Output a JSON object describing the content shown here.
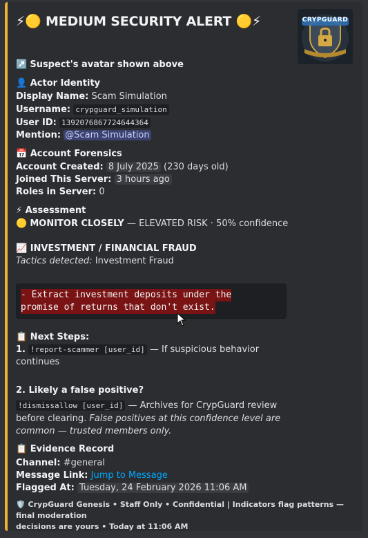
{
  "alert": {
    "title_prefix": "⚡🟡",
    "title": "MEDIUM SECURITY ALERT",
    "title_suffix": "🟡⚡",
    "accent_color": "#f0b232"
  },
  "thumbnail": {
    "alt": "CrypGuard logo",
    "brand_text": "CRYPGUARD",
    "icon": "shield-lock-icon"
  },
  "avatar_note": {
    "emoji": "↗️",
    "text": "Suspect's avatar shown above"
  },
  "actor": {
    "emoji": "👤",
    "header": "Actor Identity",
    "display_name_label": "Display Name:",
    "display_name": "Scam Simulation",
    "username_label": "Username:",
    "username": "crypguard_simulation",
    "user_id_label": "User ID:",
    "user_id": "1392076867724644364",
    "mention_label": "Mention:",
    "mention": "@Scam Simulation"
  },
  "forensics": {
    "emoji": "📅",
    "header": "Account Forensics",
    "created_label": "Account Created:",
    "created": "8 July 2025",
    "created_age": "(230 days old)",
    "joined_label": "Joined This Server:",
    "joined": "3 hours ago",
    "roles_label": "Roles in Server:",
    "roles": "0"
  },
  "assessment": {
    "emoji": "⚡",
    "header": "Assessment",
    "level_emoji": "🟡",
    "level": "MONITOR CLOSELY",
    "detail": "— ELEVATED RISK · 50% confidence"
  },
  "fraud": {
    "emoji": "📈",
    "header": "INVESTMENT / FINANCIAL FRAUD",
    "tactics_label": "Tactics detected:",
    "tactics": "Investment Fraud",
    "code_line_1": "- Extract investment deposits under the",
    "code_line_2": "promise of returns that don't exist."
  },
  "next_steps": {
    "emoji": "📋",
    "header": "Next Steps:",
    "step1_num": "1.",
    "step1_cmd": "!report-scammer [user_id]",
    "step1_text": "— If suspicious behavior",
    "step1_text2": "continues",
    "step2_header": "2. Likely a false positive?",
    "step2_cmd": "!dismissallow [user_id]",
    "step2_text": "— Archives for CrypGuard review",
    "step2_text2": "before clearing.",
    "step2_italic": "False positives at this confidence level are",
    "step2_italic2": "common — trusted members only."
  },
  "evidence": {
    "emoji": "📋",
    "header": "Evidence Record",
    "channel_label": "Channel:",
    "channel": "#general",
    "link_label": "Message Link:",
    "link_text": "Jump to Message",
    "flagged_label": "Flagged At:",
    "flagged": "Tuesday, 24 February 2026 11:06 AM"
  },
  "footer": {
    "icon": "🛡️",
    "line1": "CrypGuard Genesis • Staff Only • Confidential  |  Indicators flag patterns — final moderation",
    "line2": "decisions are yours • Today at 11:06 AM"
  }
}
